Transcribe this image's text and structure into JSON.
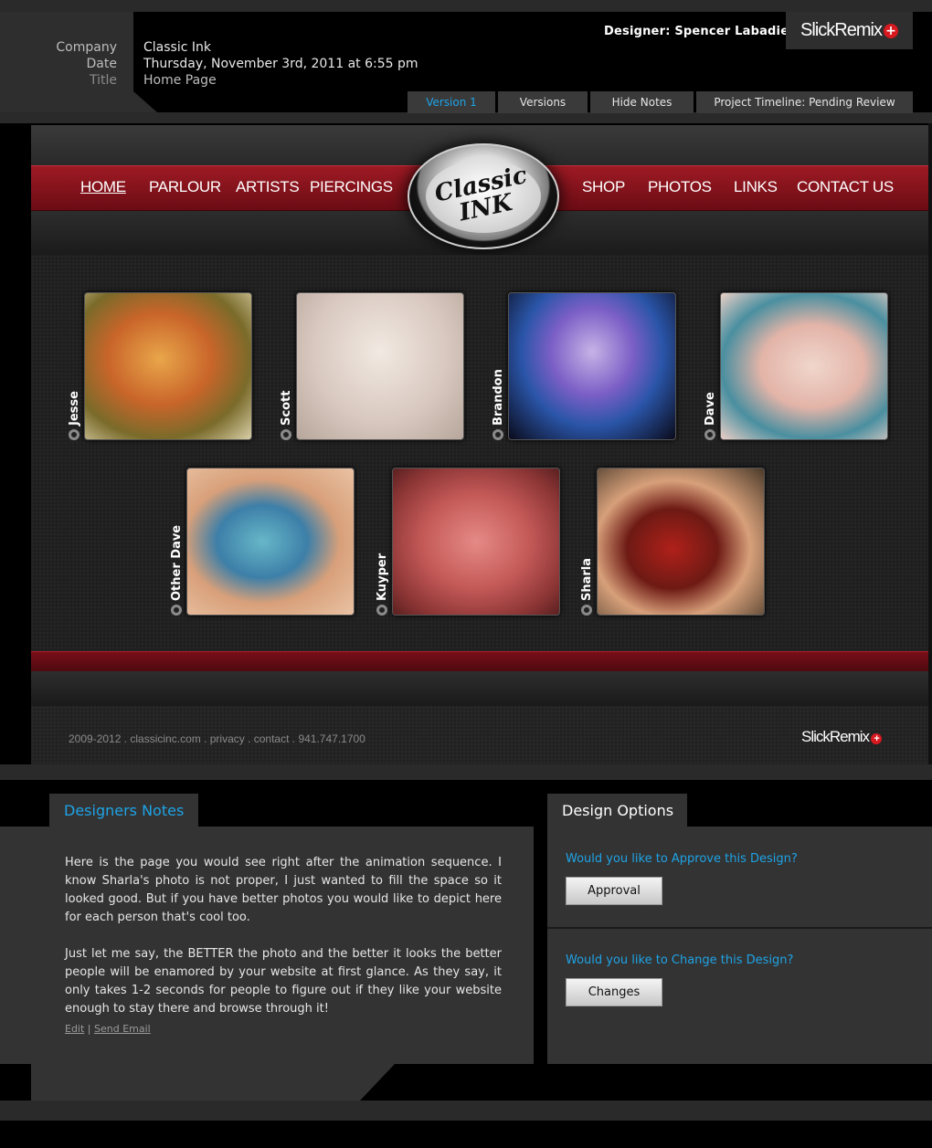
{
  "header": {
    "labels": {
      "company": "Company",
      "date": "Date",
      "title": "Title"
    },
    "values": {
      "company": "Classic Ink",
      "date": "Thursday, November 3rd, 2011 at 6:55 pm",
      "title": "Home Page"
    },
    "designer": "Designer: Spencer Labadie",
    "brand": "SlickRemix",
    "brand_plus": "+",
    "tabs": [
      {
        "label": "Version 1",
        "active": true
      },
      {
        "label": "Versions",
        "active": false
      },
      {
        "label": "Hide Notes",
        "active": false
      },
      {
        "label": "Project Timeline: Pending Review",
        "active": false
      }
    ]
  },
  "site": {
    "nav_left": [
      "HOME",
      "PARLOUR",
      "ARTISTS",
      "PIERCINGS"
    ],
    "nav_right": [
      "SHOP",
      "PHOTOS",
      "LINKS",
      "CONTACT US"
    ],
    "logo_text": "Classic INK",
    "artists": [
      "Jesse",
      "Scott",
      "Brandon",
      "Dave",
      "Other Dave",
      "Kuyper",
      "Sharla"
    ],
    "footer_text": "2009-2012 . classicinc.com .  privacy . contact  . 941.747.1700",
    "footer_brand": "SlickRemix",
    "accent": "#9e1a24"
  },
  "notes": {
    "tab": "Designers Notes",
    "paragraphs": [
      "Here is the page you would see right after the animation sequence. I know Sharla's photo is not proper, I just wanted to fill the space so it looked good. But if you have better photos you would like to depict here for each person that's cool too.",
      "Just let me say, the BETTER the photo and the better it looks the better people will be enamored by your website at first glance. As they say, it only takes 1-2 seconds for people to figure out if they like your website enough to stay there and browse through it!"
    ],
    "edit": "Edit",
    "sep": " | ",
    "send_email": "Send Email"
  },
  "options": {
    "tab": "Design Options",
    "approve_q": "Would you like to Approve this Design?",
    "approve_btn": "Approval",
    "change_q": "Would you like to Change this Design?",
    "change_btn": "Changes"
  },
  "colors": {
    "link_blue": "#1ea3e6",
    "panel": "#333333",
    "brand_red": "#d71920"
  }
}
